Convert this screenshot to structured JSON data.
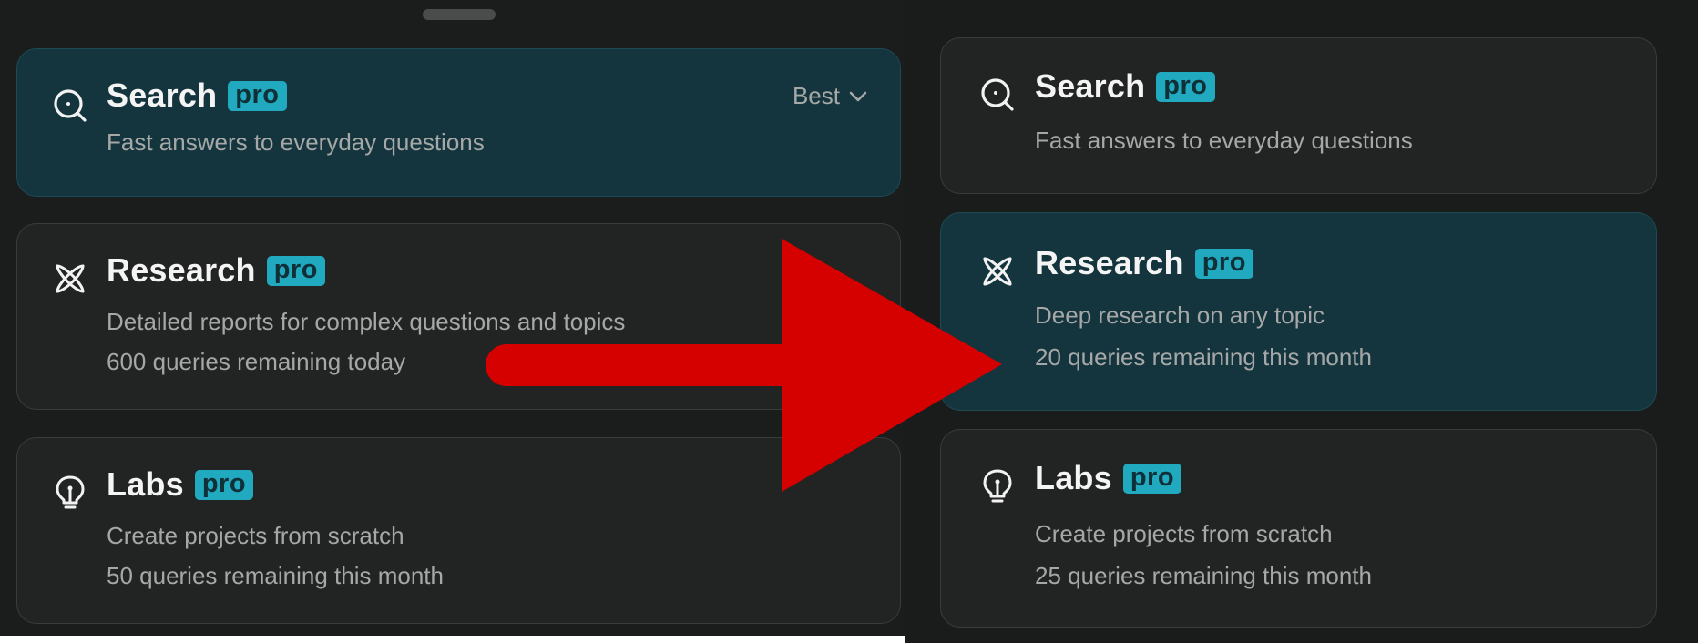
{
  "left_panel": {
    "cards": [
      {
        "title": "Search",
        "badge": "pro",
        "description": "Fast answers to everyday questions",
        "dropdown": "Best",
        "icon": "search-icon"
      },
      {
        "title": "Research",
        "badge": "pro",
        "description": "Detailed reports for complex questions and topics",
        "quota": "600 queries remaining today",
        "icon": "research-icon"
      },
      {
        "title": "Labs",
        "badge": "pro",
        "description": "Create projects from scratch",
        "quota": "50 queries remaining this month",
        "icon": "lightbulb-icon"
      }
    ]
  },
  "right_panel": {
    "cards": [
      {
        "title": "Search",
        "badge": "pro",
        "description": "Fast answers to everyday questions",
        "icon": "search-icon"
      },
      {
        "title": "Research",
        "badge": "pro",
        "description": "Deep research on any topic",
        "quota": "20 queries remaining this month",
        "icon": "research-icon"
      },
      {
        "title": "Labs",
        "badge": "pro",
        "description": "Create projects from scratch",
        "quota": "25 queries remaining this month",
        "icon": "lightbulb-icon"
      }
    ]
  },
  "colors": {
    "background": "#1b1c1c",
    "card": "#222323",
    "card_selected": "#14353d",
    "badge": "#21a9bf",
    "arrow": "#d50000"
  }
}
